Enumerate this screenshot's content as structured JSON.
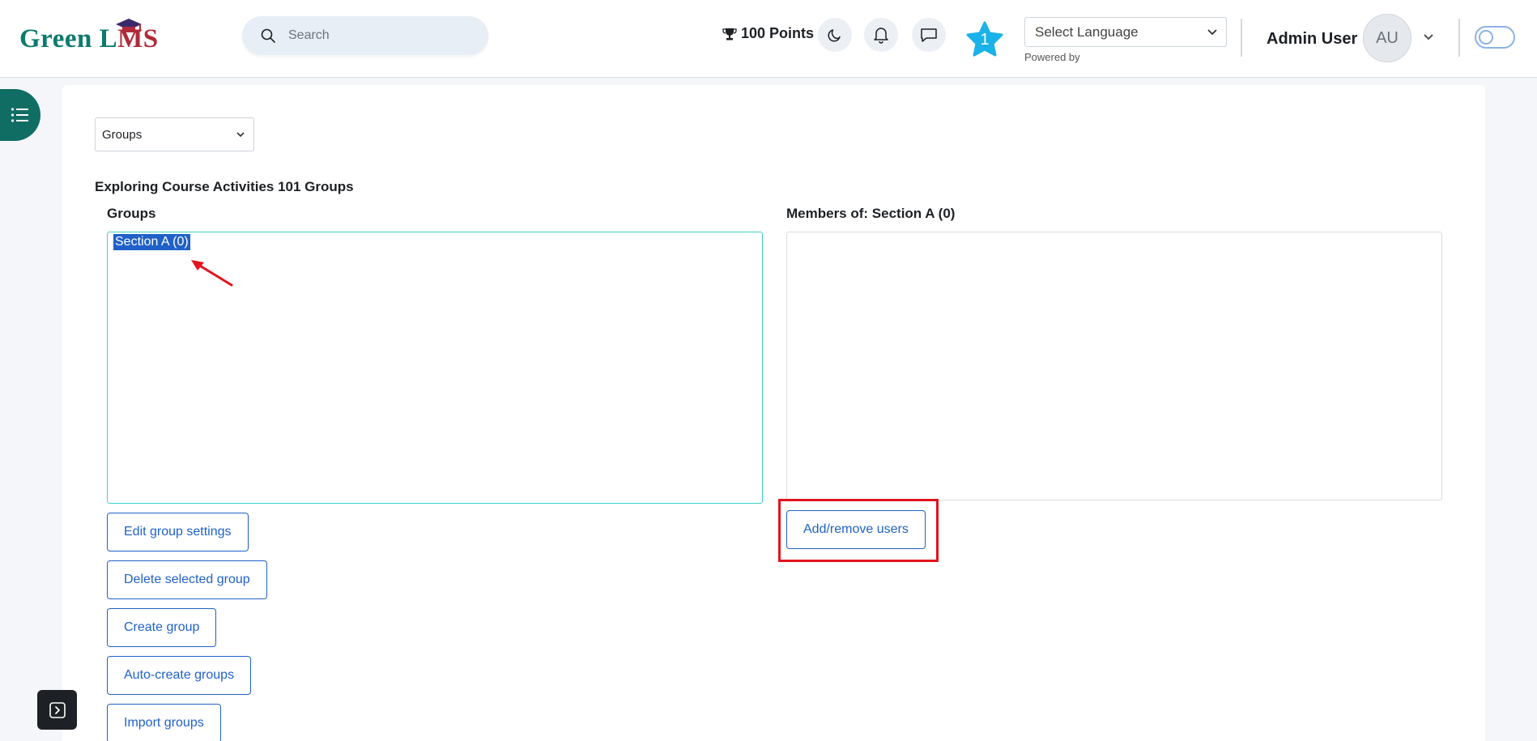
{
  "header": {
    "logo_text_1": "Green L",
    "logo_text_2": "MS",
    "search": {
      "placeholder": "Search"
    },
    "points_label": "100 Points",
    "star_count": "1",
    "language": {
      "selected": "Select Language",
      "powered_by": "Powered by"
    },
    "user": {
      "name": "Admin User",
      "initials": "AU"
    }
  },
  "main": {
    "page_select": {
      "selected": "Groups"
    },
    "heading": "Exploring Course Activities 101 Groups",
    "groups_label": "Groups",
    "groups": [
      {
        "label": "Section A (0)",
        "selected": true
      }
    ],
    "members_label": "Members of: Section A (0)",
    "buttons": {
      "edit": "Edit group settings",
      "delete": "Delete selected group",
      "create": "Create group",
      "auto_create": "Auto-create groups",
      "import": "Import groups",
      "add_remove": "Add/remove users"
    }
  },
  "colors": {
    "brand_teal": "#0f6d64",
    "primary_blue": "#1f61c7",
    "highlight_red": "#e3141e",
    "star_blue": "#1ab2e8"
  },
  "icons": [
    "search-icon",
    "trophy-icon",
    "moon-icon",
    "bell-icon",
    "chat-icon",
    "star-icon",
    "chevron-down-icon",
    "menu-list-icon",
    "sidebar-toggle-icon",
    "arrow-annotation-icon"
  ]
}
